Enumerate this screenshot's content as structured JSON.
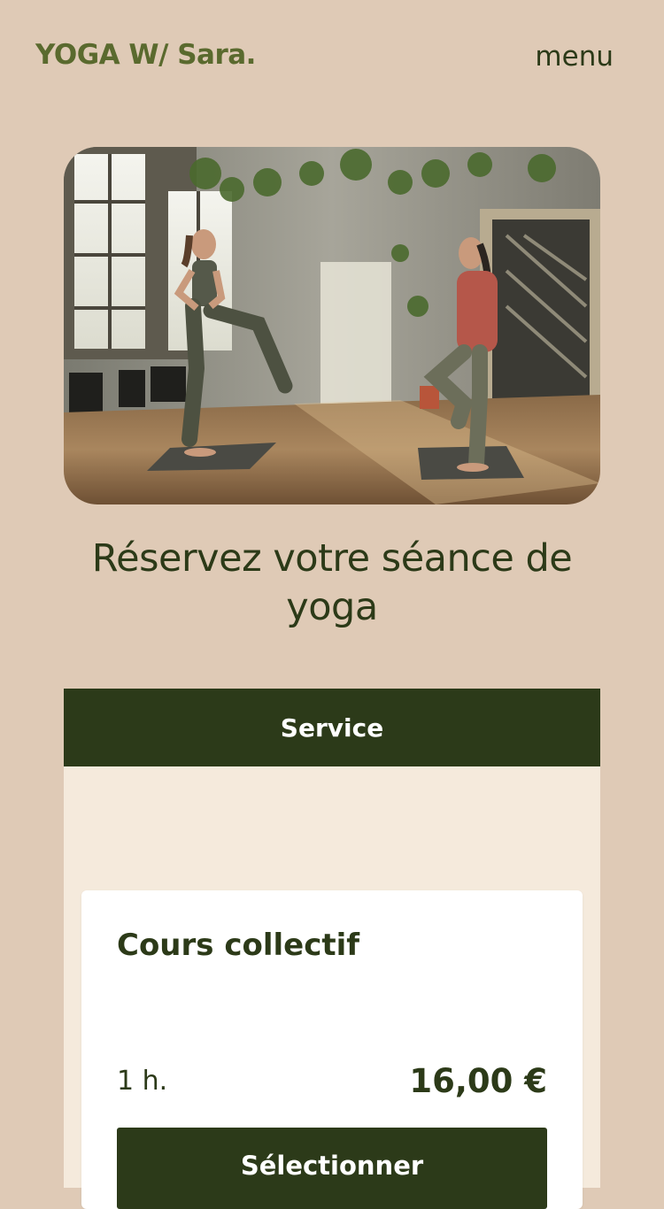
{
  "header": {
    "brand": "YOGA W/ Sara.",
    "menu_label": "menu"
  },
  "hero": {
    "image_icon": "yoga-studio-photo"
  },
  "main": {
    "title": "Réservez votre séance de yoga"
  },
  "service": {
    "header_label": "Service",
    "card": {
      "title": "Cours collectif",
      "duration": "1 h.",
      "price": "16,00 €",
      "button_label": "Sélectionner"
    }
  },
  "colors": {
    "background": "#dfcab6",
    "accent_dark_green": "#2c3a19",
    "brand_green": "#5a6a2e",
    "panel": "#f5eadc",
    "card": "#ffffff"
  }
}
